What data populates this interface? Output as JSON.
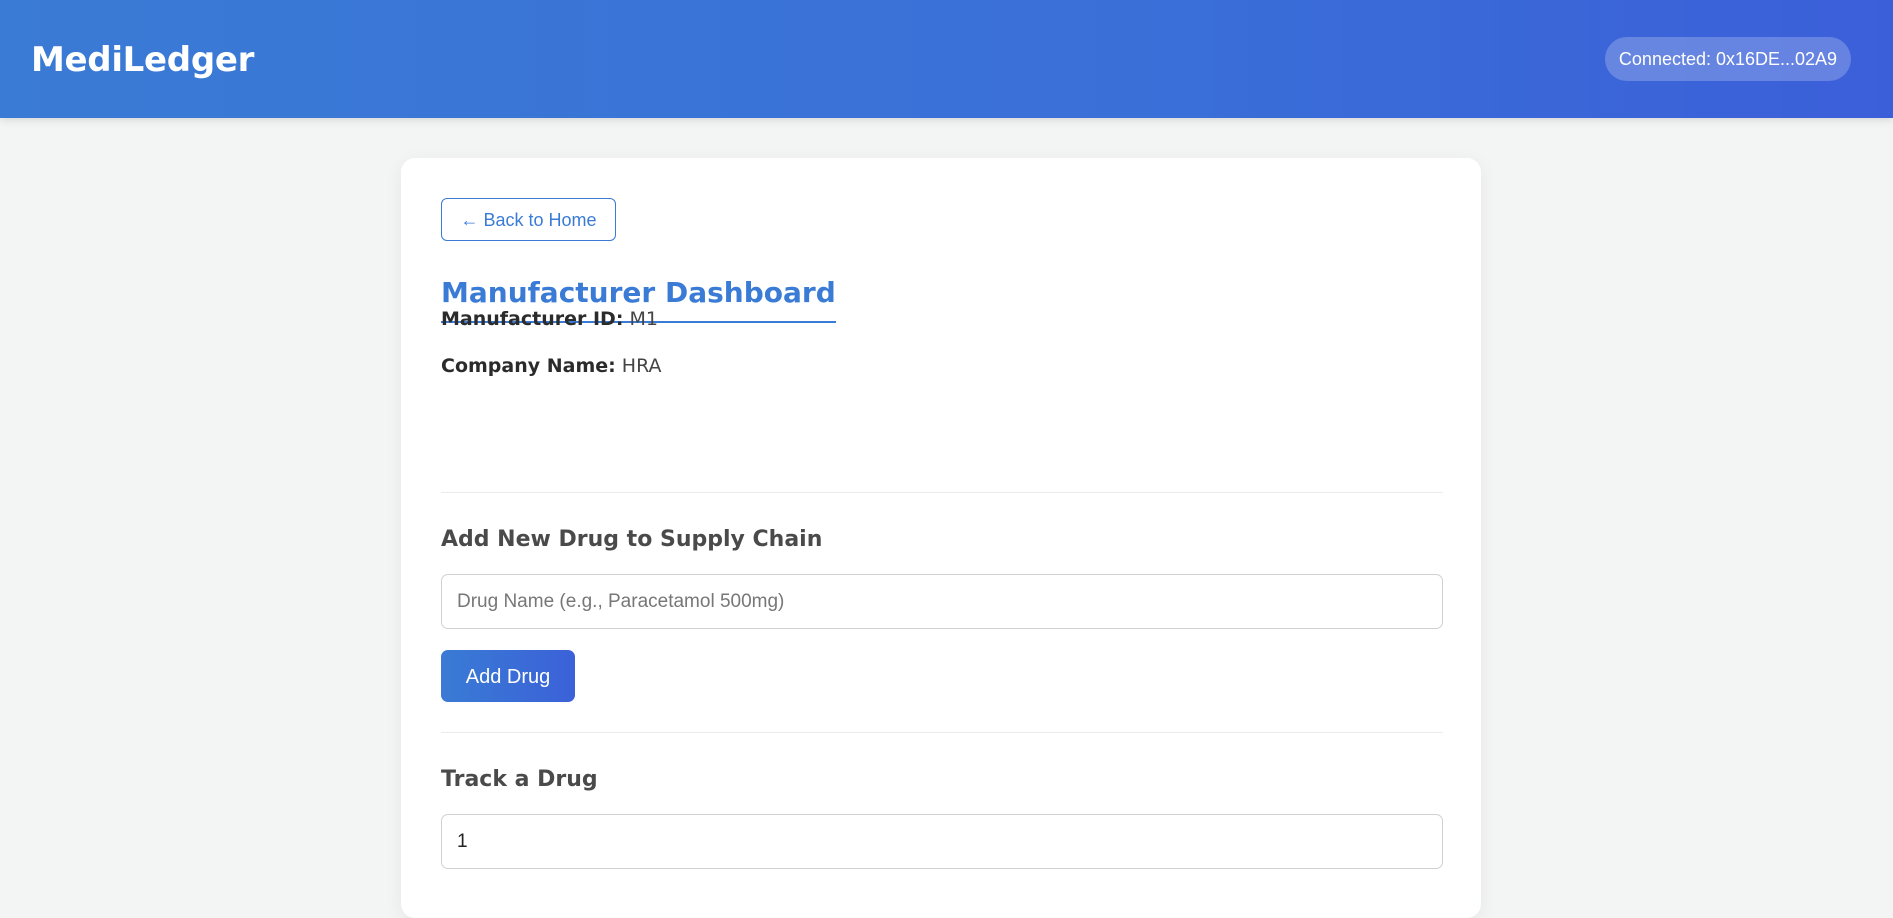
{
  "header": {
    "app_title": "MediLedger",
    "connection_status": "Connected: 0x16DE...02A9"
  },
  "main": {
    "back_label": "← Back to Home",
    "page_title": "Manufacturer Dashboard",
    "manufacturer_info": {
      "id_label": "Manufacturer ID:",
      "id_value": "M1",
      "company_label": "Company Name:",
      "company_value": "HRA"
    },
    "add_drug": {
      "title": "Add New Drug to Supply Chain",
      "input_placeholder": "Drug Name (e.g., Paracetamol 500mg)",
      "input_value": "",
      "button_label": "Add Drug"
    },
    "track_drug": {
      "title": "Track a Drug",
      "input_value": "1"
    }
  },
  "colors": {
    "accent": "#3a7bd5",
    "header_gradient_end": "#3b5fd9",
    "page_background": "#f3f4f4"
  }
}
